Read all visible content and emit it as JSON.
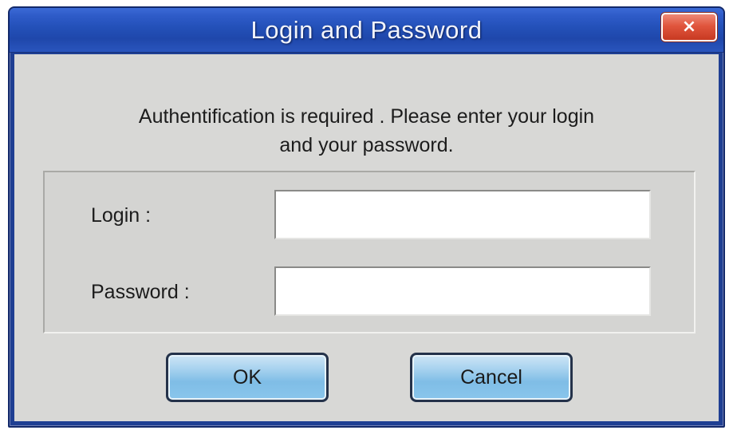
{
  "window": {
    "title": "Login and Password",
    "close_label": "×"
  },
  "message": {
    "line1": "Authentification is required . Please enter your login",
    "line2": "and your password."
  },
  "fields": {
    "login_label": "Login :",
    "login_value": "",
    "password_label": "Password :",
    "password_value": ""
  },
  "buttons": {
    "ok_label": "OK",
    "cancel_label": "Cancel"
  },
  "colors": {
    "titlebar": "#2350b8",
    "close_button": "#e0553d",
    "dialog_background": "#d8d8d6",
    "button_fill": "#a9d3ef"
  },
  "icons": {
    "close": "close-icon"
  }
}
